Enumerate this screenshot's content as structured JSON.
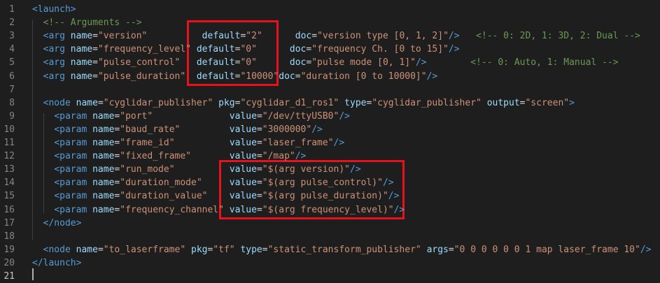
{
  "colors": {
    "background": "#1e1e1e",
    "line_number": "#858585",
    "tag": "#569cd6",
    "attribute": "#9cdcfe",
    "string": "#ce9178",
    "comment": "#6a9955",
    "highlight_box": "#e8111c"
  },
  "active_line": 21,
  "line_numbers": [
    "1",
    "2",
    "3",
    "4",
    "5",
    "6",
    "7",
    "8",
    "9",
    "10",
    "11",
    "12",
    "13",
    "14",
    "15",
    "16",
    "17",
    "18",
    "19",
    "20",
    "21"
  ],
  "lines": [
    [
      [
        "t",
        "<launch>"
      ]
    ],
    [
      [
        "c",
        "  <!-- Arguments -->"
      ]
    ],
    [
      [
        "p",
        "  "
      ],
      [
        "t",
        "<arg "
      ],
      [
        "a",
        "name"
      ],
      [
        "p",
        "="
      ],
      [
        "s",
        "\"version\""
      ],
      [
        "p",
        "          "
      ],
      [
        "a",
        "default"
      ],
      [
        "p",
        "="
      ],
      [
        "s",
        "\"2\""
      ],
      [
        "p",
        "      "
      ],
      [
        "a",
        "doc"
      ],
      [
        "p",
        "="
      ],
      [
        "s",
        "\"version type [0, 1, 2]\""
      ],
      [
        "t",
        "/>"
      ],
      [
        "p",
        "   "
      ],
      [
        "c",
        "<!-- 0: 2D, 1: 3D, 2: Dual -->"
      ]
    ],
    [
      [
        "p",
        "  "
      ],
      [
        "t",
        "<arg "
      ],
      [
        "a",
        "name"
      ],
      [
        "p",
        "="
      ],
      [
        "s",
        "\"frequency_level\""
      ],
      [
        "p",
        " "
      ],
      [
        "a",
        "default"
      ],
      [
        "p",
        "="
      ],
      [
        "s",
        "\"0\""
      ],
      [
        "p",
        "      "
      ],
      [
        "a",
        "doc"
      ],
      [
        "p",
        "="
      ],
      [
        "s",
        "\"frequency Ch. [0 to 15]\""
      ],
      [
        "t",
        "/>"
      ]
    ],
    [
      [
        "p",
        "  "
      ],
      [
        "t",
        "<arg "
      ],
      [
        "a",
        "name"
      ],
      [
        "p",
        "="
      ],
      [
        "s",
        "\"pulse_control\""
      ],
      [
        "p",
        "   "
      ],
      [
        "a",
        "default"
      ],
      [
        "p",
        "="
      ],
      [
        "s",
        "\"0\""
      ],
      [
        "p",
        "      "
      ],
      [
        "a",
        "doc"
      ],
      [
        "p",
        "="
      ],
      [
        "s",
        "\"pulse mode [0, 1]\""
      ],
      [
        "t",
        "/>"
      ],
      [
        "p",
        "        "
      ],
      [
        "c",
        "<!-- 0: Auto, 1: Manual -->"
      ]
    ],
    [
      [
        "p",
        "  "
      ],
      [
        "t",
        "<arg "
      ],
      [
        "a",
        "name"
      ],
      [
        "p",
        "="
      ],
      [
        "s",
        "\"pulse_duration\""
      ],
      [
        "p",
        "  "
      ],
      [
        "a",
        "default"
      ],
      [
        "p",
        "="
      ],
      [
        "s",
        "\"10000\""
      ],
      [
        "p",
        ""
      ],
      [
        "a",
        "doc"
      ],
      [
        "p",
        "="
      ],
      [
        "s",
        "\"duration [0 to 10000]\""
      ],
      [
        "t",
        "/>"
      ]
    ],
    [],
    [
      [
        "p",
        "  "
      ],
      [
        "t",
        "<node "
      ],
      [
        "a",
        "name"
      ],
      [
        "p",
        "="
      ],
      [
        "s",
        "\"cyglidar_publisher\""
      ],
      [
        "p",
        " "
      ],
      [
        "a",
        "pkg"
      ],
      [
        "p",
        "="
      ],
      [
        "s",
        "\"cyglidar_d1_ros1\""
      ],
      [
        "p",
        " "
      ],
      [
        "a",
        "type"
      ],
      [
        "p",
        "="
      ],
      [
        "s",
        "\"cyglidar_publisher\""
      ],
      [
        "p",
        " "
      ],
      [
        "a",
        "output"
      ],
      [
        "p",
        "="
      ],
      [
        "s",
        "\"screen\""
      ],
      [
        "t",
        ">"
      ]
    ],
    [
      [
        "p",
        "    "
      ],
      [
        "t",
        "<param "
      ],
      [
        "a",
        "name"
      ],
      [
        "p",
        "="
      ],
      [
        "s",
        "\"port\""
      ],
      [
        "p",
        "              "
      ],
      [
        "a",
        "value"
      ],
      [
        "p",
        "="
      ],
      [
        "s",
        "\"/dev/ttyUSB0\""
      ],
      [
        "t",
        "/>"
      ]
    ],
    [
      [
        "p",
        "    "
      ],
      [
        "t",
        "<param "
      ],
      [
        "a",
        "name"
      ],
      [
        "p",
        "="
      ],
      [
        "s",
        "\"baud_rate\""
      ],
      [
        "p",
        "         "
      ],
      [
        "a",
        "value"
      ],
      [
        "p",
        "="
      ],
      [
        "s",
        "\"3000000\""
      ],
      [
        "t",
        "/>"
      ]
    ],
    [
      [
        "p",
        "    "
      ],
      [
        "t",
        "<param "
      ],
      [
        "a",
        "name"
      ],
      [
        "p",
        "="
      ],
      [
        "s",
        "\"frame_id\""
      ],
      [
        "p",
        "          "
      ],
      [
        "a",
        "value"
      ],
      [
        "p",
        "="
      ],
      [
        "s",
        "\"laser_frame\""
      ],
      [
        "t",
        "/>"
      ]
    ],
    [
      [
        "p",
        "    "
      ],
      [
        "t",
        "<param "
      ],
      [
        "a",
        "name"
      ],
      [
        "p",
        "="
      ],
      [
        "s",
        "\"fixed_frame\""
      ],
      [
        "p",
        "       "
      ],
      [
        "a",
        "value"
      ],
      [
        "p",
        "="
      ],
      [
        "s",
        "\"/map\""
      ],
      [
        "t",
        "/>"
      ]
    ],
    [
      [
        "p",
        "    "
      ],
      [
        "t",
        "<param "
      ],
      [
        "a",
        "name"
      ],
      [
        "p",
        "="
      ],
      [
        "s",
        "\"run_mode\""
      ],
      [
        "p",
        "          "
      ],
      [
        "a",
        "value"
      ],
      [
        "p",
        "="
      ],
      [
        "s",
        "\"$(arg version)\""
      ],
      [
        "t",
        "/>"
      ]
    ],
    [
      [
        "p",
        "    "
      ],
      [
        "t",
        "<param "
      ],
      [
        "a",
        "name"
      ],
      [
        "p",
        "="
      ],
      [
        "s",
        "\"duration_mode\""
      ],
      [
        "p",
        "     "
      ],
      [
        "a",
        "value"
      ],
      [
        "p",
        "="
      ],
      [
        "s",
        "\"$(arg pulse_control)\""
      ],
      [
        "t",
        "/>"
      ]
    ],
    [
      [
        "p",
        "    "
      ],
      [
        "t",
        "<param "
      ],
      [
        "a",
        "name"
      ],
      [
        "p",
        "="
      ],
      [
        "s",
        "\"duration_value\""
      ],
      [
        "p",
        "    "
      ],
      [
        "a",
        "value"
      ],
      [
        "p",
        "="
      ],
      [
        "s",
        "\"$(arg pulse_duration)\""
      ],
      [
        "t",
        "/>"
      ]
    ],
    [
      [
        "p",
        "    "
      ],
      [
        "t",
        "<param "
      ],
      [
        "a",
        "name"
      ],
      [
        "p",
        "="
      ],
      [
        "s",
        "\"frequency_channel\""
      ],
      [
        "p",
        " "
      ],
      [
        "a",
        "value"
      ],
      [
        "p",
        "="
      ],
      [
        "s",
        "\"$(arg frequency_level)\""
      ],
      [
        "t",
        "/>"
      ]
    ],
    [
      [
        "p",
        "  "
      ],
      [
        "t",
        "</node>"
      ]
    ],
    [],
    [
      [
        "p",
        "  "
      ],
      [
        "t",
        "<node "
      ],
      [
        "a",
        "name"
      ],
      [
        "p",
        "="
      ],
      [
        "s",
        "\"to_laserframe\""
      ],
      [
        "p",
        " "
      ],
      [
        "a",
        "pkg"
      ],
      [
        "p",
        "="
      ],
      [
        "s",
        "\"tf\""
      ],
      [
        "p",
        " "
      ],
      [
        "a",
        "type"
      ],
      [
        "p",
        "="
      ],
      [
        "s",
        "\"static_transform_publisher\""
      ],
      [
        "p",
        " "
      ],
      [
        "a",
        "args"
      ],
      [
        "p",
        "="
      ],
      [
        "s",
        "\"0 0 0 0 0 0 1 map laser_frame 10\""
      ],
      [
        "t",
        "/>"
      ]
    ],
    [
      [
        "t",
        "</launch>"
      ]
    ],
    []
  ]
}
